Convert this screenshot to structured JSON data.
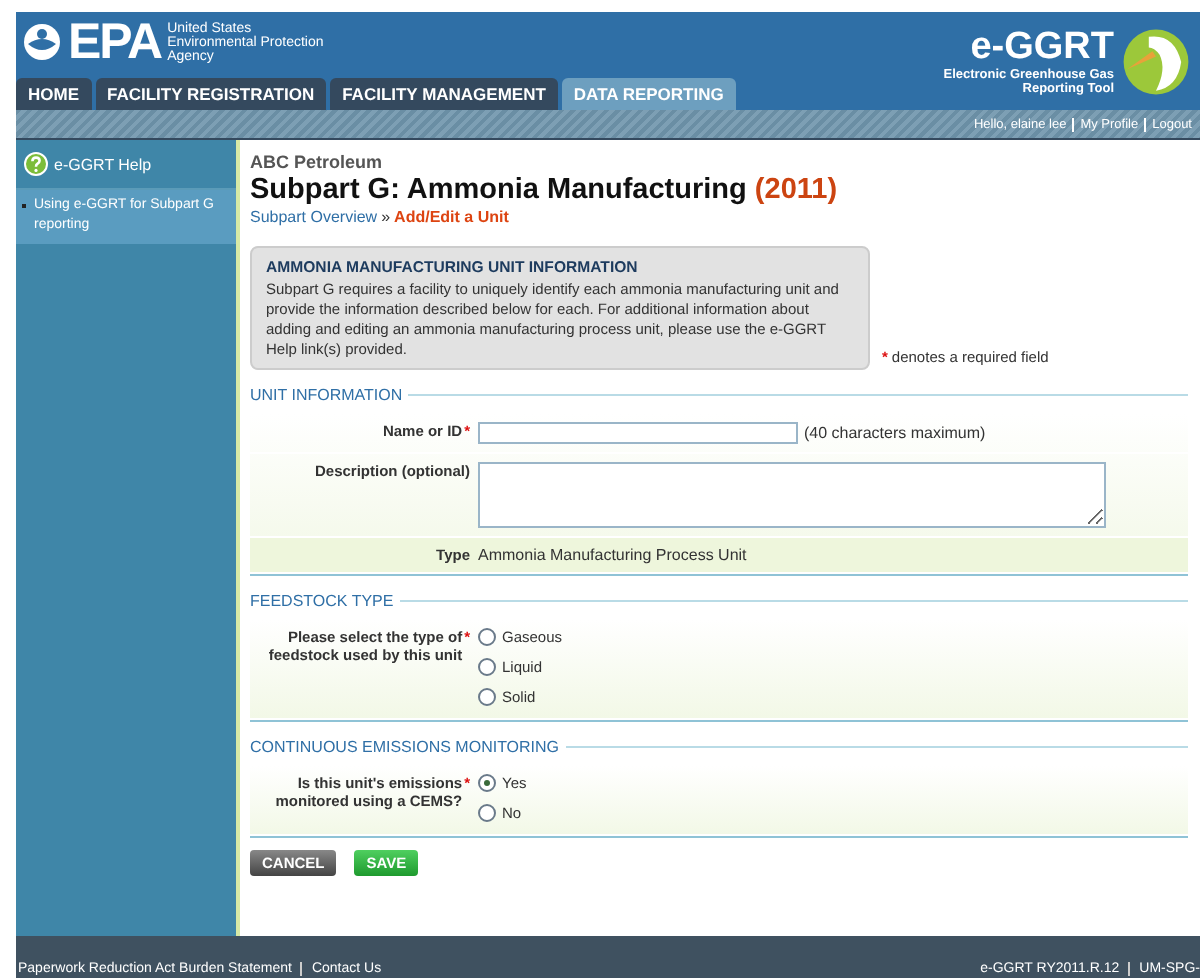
{
  "header": {
    "logo": "EPA",
    "agency_lines": [
      "United States",
      "Environmental Protection",
      "Agency"
    ],
    "app_name": "e-GGRT",
    "app_subtitle_lines": [
      "Electronic Greenhouse Gas",
      "Reporting Tool"
    ],
    "tabs": [
      {
        "label": "HOME",
        "selected": false
      },
      {
        "label": "FACILITY REGISTRATION",
        "selected": false
      },
      {
        "label": "FACILITY MANAGEMENT",
        "selected": false
      },
      {
        "label": "DATA REPORTING",
        "selected": true
      }
    ],
    "user_links": [
      "Hello, elaine lee",
      "My Profile",
      "Logout"
    ]
  },
  "sidebar": {
    "help": "e-GGRT Help",
    "items": [
      {
        "label": "Using e-GGRT for Subpart G reporting",
        "selected": true
      }
    ]
  },
  "main": {
    "facility": "ABC Petroleum",
    "title": "Subpart G: Ammonia Manufacturing",
    "year": "(2011)",
    "breadcrumb": [
      {
        "label": "Subpart Overview",
        "current": false
      },
      {
        "label": "Add/Edit a Unit",
        "current": true
      }
    ],
    "breadcrumb_separator": "»",
    "info_box": {
      "title": "AMMONIA MANUFACTURING UNIT INFORMATION",
      "text": "Subpart G requires a facility to uniquely identify each ammonia manufacturing unit and provide the information described below for each. For additional information about adding and editing an ammonia manufacturing process unit, please use the e-GGRT Help link(s) provided."
    },
    "required_mark": "*",
    "required_note": "denotes a required field",
    "sections": [
      {
        "heading": "UNIT INFORMATION",
        "fields": [
          {
            "kind": "text",
            "label": "Name or ID",
            "required": true,
            "hint": "(40 characters maximum)"
          },
          {
            "kind": "textarea",
            "label": "Description (optional)",
            "required": false
          },
          {
            "kind": "static",
            "label": "Type",
            "value": "Ammonia Manufacturing Process Unit",
            "required": false
          }
        ]
      },
      {
        "heading": "FEEDSTOCK TYPE",
        "fields": [
          {
            "kind": "radio",
            "label": "Please select the type of feedstock used by this unit",
            "required": true,
            "options": [
              {
                "label": "Gaseous",
                "selected": false
              },
              {
                "label": "Liquid",
                "selected": false
              },
              {
                "label": "Solid",
                "selected": false
              }
            ]
          }
        ]
      },
      {
        "heading": "CONTINUOUS EMISSIONS MONITORING",
        "fields": [
          {
            "kind": "radio",
            "label": "Is this unit's emissions monitored using a CEMS?",
            "required": true,
            "options": [
              {
                "label": "Yes",
                "selected": true
              },
              {
                "label": "No",
                "selected": false
              }
            ]
          }
        ]
      }
    ],
    "buttons": [
      {
        "label": "CANCEL",
        "kind": "cancel"
      },
      {
        "label": "SAVE",
        "kind": "save"
      }
    ]
  },
  "footer": {
    "left_links": [
      "Paperwork Reduction Act Burden Statement",
      "Contact Us"
    ],
    "right_texts": [
      "e-GGRT RY2011.R.12",
      "UM-SPG-"
    ]
  }
}
